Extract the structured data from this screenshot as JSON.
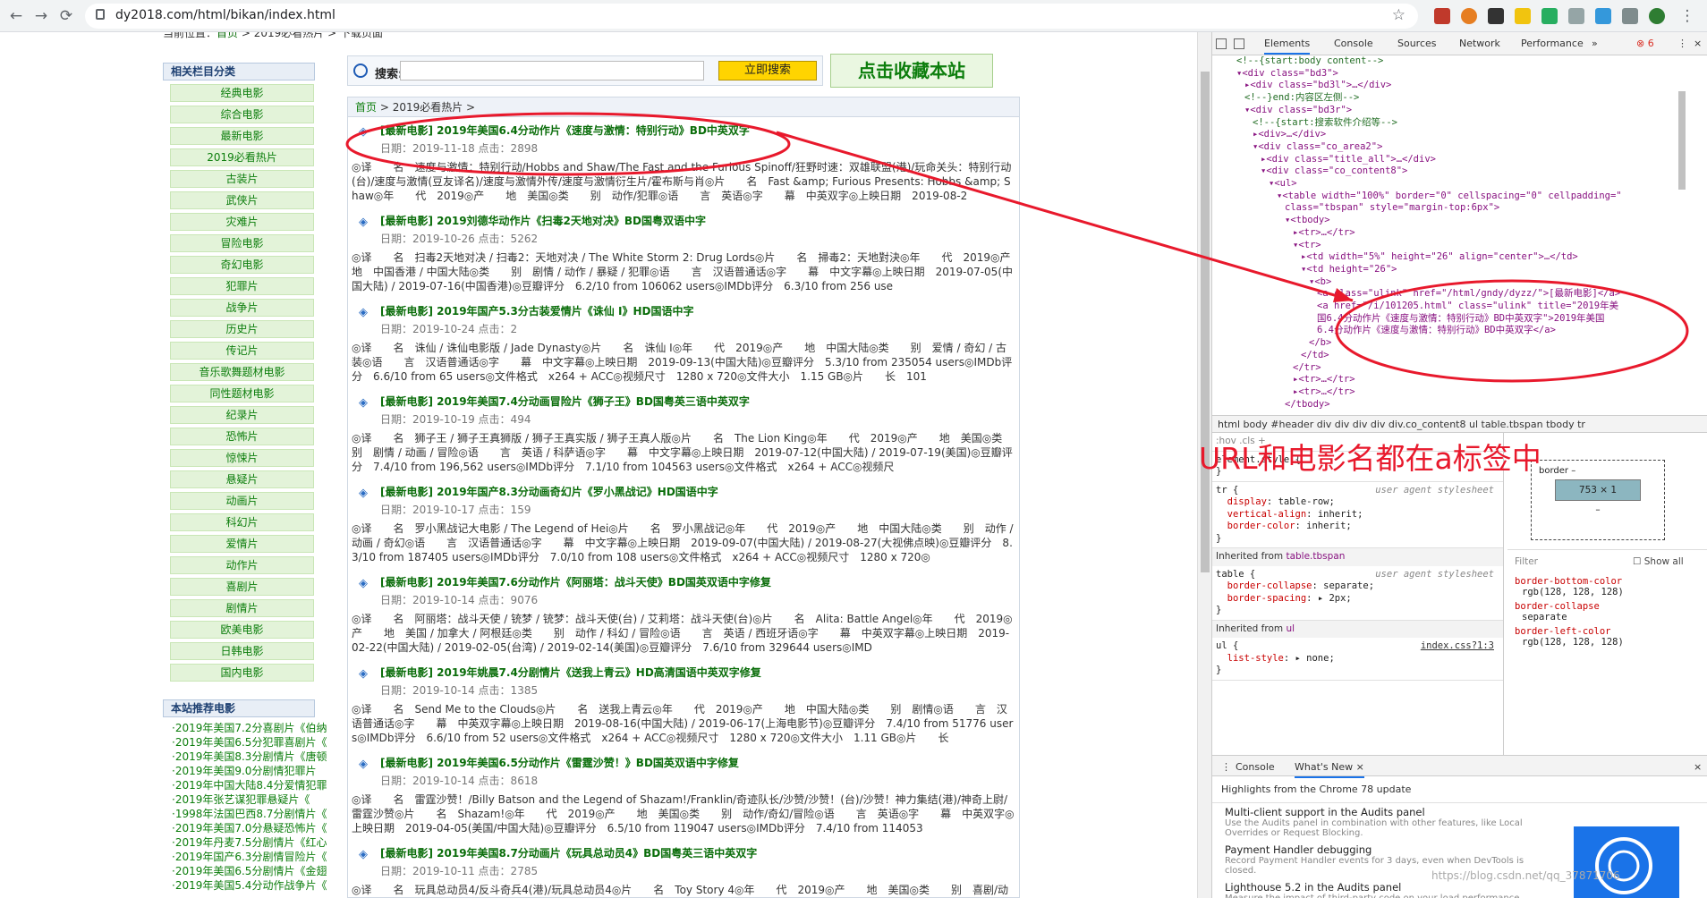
{
  "browser": {
    "url": "dy2018.com/html/bikan/index.html",
    "back": "←",
    "forward": "→",
    "reload": "⟳",
    "star": "☆"
  },
  "page": {
    "crumb_prefix": "当前位置：",
    "crumb_home": "首页",
    "crumb_rest": " > 2019必看热片 > 下载页面",
    "sidebar_heading": "相关栏目分类",
    "categories": [
      "经典电影",
      "综合电影",
      "最新电影",
      "2019必看热片",
      "古装片",
      "武侠片",
      "灾难片",
      "冒险电影",
      "奇幻电影",
      "犯罪片",
      "战争片",
      "历史片",
      "传记片",
      "音乐歌舞题材电影",
      "同性题材电影",
      "纪录片",
      "恐怖片",
      "惊悚片",
      "悬疑片",
      "动画片",
      "科幻片",
      "爱情片",
      "动作片",
      "喜剧片",
      "剧情片",
      "欧美电影",
      "日韩电影",
      "国内电影"
    ],
    "rec_heading": "本站推荐电影",
    "recommended": [
      "·2019年美国7.2分喜剧片《伯纳",
      "·2019年美国6.5分犯罪喜剧片《",
      "·2019年美国8.3分剧情片《唐顿",
      "·2019年美国9.0分剧情犯罪片",
      "·2019年中国大陆8.4分爱情犯罪",
      "·2019年张艺谋犯罪悬疑片《",
      "·1998年法国巴西8.7分剧情片《",
      "·2019年美国7.0分悬疑恐怖片《",
      "·2019年丹麦7.5分剧情片《红心",
      "·2019年国产6.3分剧情冒险片《",
      "·2019年美国6.5分剧情片《金翅",
      "·2019年美国5.4分动作战争片《"
    ],
    "search_label": "搜索:",
    "search_button": "立即搜索",
    "fav_button": "点击收藏本站",
    "list_crumb_home": "首页",
    "list_crumb_rest": " > 2019必看热片 > ",
    "items": [
      {
        "title": "[最新电影] 2019年美国6.4分动作片《速度与激情：特别行动》BD中英双字",
        "meta": "日期：2019-11-18 点击：2898",
        "desc": "◎译　　名　速度与激情：特别行动/Hobbs and Shaw/The Fast and the Furious Spinoff/狂野时速：双雄联盟(港)/玩命关头：特别行动(台)/速度与激情(豆友译名)/速度与激情外传/速度与激情衍生片/霍布斯与肖◎片　　名　Fast &amp; Furious Presents: Hobbs &amp; Shaw◎年　　代　2019◎产　　地　美国◎类　　别　动作/犯罪◎语　　言　英语◎字　　幕　中英双字◎上映日期　2019-08-2"
      },
      {
        "title": "[最新电影] 2019刘德华动作片《扫毒2天地对决》BD国粤双语中字",
        "meta": "日期：2019-10-26 点击：5262",
        "desc": "◎译　　名　扫毒2天地对决 / 扫毒2：天地对决 / The White Storm 2: Drug Lords◎片　　名　掃毒2：天地對決◎年　　代　2019◎产　　地　中国香港 / 中国大陆◎类　　别　剧情 / 动作 / 暴疑 / 犯罪◎语　　言　汉语普通话◎字　　幕　中文字幕◎上映日期　2019-07-05(中国大陆) / 2019-07-16(中国香港)◎豆瓣评分　6.2/10 from 106062 users◎IMDb评分　6.3/10 from 256 use"
      },
      {
        "title": "[最新电影] 2019年国产5.3分古装爱情片《诛仙 Ⅰ》HD国语中字",
        "meta": "日期：2019-10-24 点击：2",
        "desc": "◎译　　名　诛仙 / 诛仙电影版 / Jade Dynasty◎片　　名　诛仙 Ⅰ◎年　　代　2019◎产　　地　中国大陆◎类　　别　爱情 / 奇幻 / 古装◎语　　言　汉语普通话◎字　　幕　中文字幕◎上映日期　2019-09-13(中国大陆)◎豆瓣评分　5.3/10 from 235054 users◎IMDb评分　6.6/10 from 65 users◎文件格式　x264 + ACC◎视频尺寸　1280 x 720◎文件大小　1.15 GB◎片　　长　101"
      },
      {
        "title": "[最新电影] 2019年美国7.4分动画冒险片《狮子王》BD国粤英三语中英双字",
        "meta": "日期：2019-10-19 点击：494",
        "desc": "◎译　　名　狮子王 / 狮子王真狮版 / 狮子王真实版 / 狮子王真人版◎片　　名　The Lion King◎年　　代　2019◎产　　地　美国◎类　　别　剧情 / 动画 / 冒险◎语　　言　英语 / 科萨语◎字　　幕　中文字幕◎上映日期　2019-07-12(中国大陆) / 2019-07-19(美国)◎豆瓣评分　7.4/10 from 196,562 users◎IMDb评分　7.1/10 from 104563 users◎文件格式　x264 + ACC◎视频尺"
      },
      {
        "title": "[最新电影] 2019年国产8.3分动画奇幻片《罗小黑战记》HD国语中字",
        "meta": "日期：2019-10-17 点击：159",
        "desc": "◎译　　名　罗小黑战记大电影 / The Legend of Hei◎片　　名　罗小黑战记◎年　　代　2019◎产　　地　中国大陆◎类　　别　动作 / 动画 / 奇幻◎语　　言　汉语普通话◎字　　幕　中文字幕◎上映日期　2019-09-07(中国大陆) / 2019-08-27(大视佛点映)◎豆瓣评分　8.3/10 from 187405 users◎IMDb评分　7.0/10 from 108 users◎文件格式　x264 + ACC◎视频尺寸　1280 x 720◎"
      },
      {
        "title": "[最新电影] 2019年美国7.6分动作片《阿丽塔：战斗天使》BD国英双语中字修复",
        "meta": "日期：2019-10-14 点击：9076",
        "desc": "◎译　　名　阿丽塔：战斗天使 / 铳梦 / 铳梦：战斗天使(台) / 艾莉塔：战斗天使(台)◎片　　名　Alita: Battle Angel◎年　　代　2019◎产　　地　美国 / 加拿大 / 阿根廷◎类　　别　动作 / 科幻 / 冒险◎语　　言　英语 / 西班牙语◎字　　幕　中英双字幕◎上映日期　2019-02-22(中国大陆) / 2019-02-05(台湾) / 2019-02-14(美国)◎豆瓣评分　7.6/10 from 329644 users◎IMD"
      },
      {
        "title": "[最新电影] 2019年姚晨7.4分剧情片《送我上青云》HD高清国语中英双字修复",
        "meta": "日期：2019-10-14 点击：1385",
        "desc": "◎译　　名　Send Me to the Clouds◎片　　名　送我上青云◎年　　代　2019◎产　　地　中国大陆◎类　　别　剧情◎语　　言　汉语普通话◎字　　幕　中英双字幕◎上映日期　2019-08-16(中国大陆) / 2019-06-17(上海电影节)◎豆瓣评分　7.4/10 from 51776 users◎IMDb评分　6.6/10 from 52 users◎文件格式　x264 + ACC◎视频尺寸　1280 x 720◎文件大小　1.11 GB◎片　　长"
      },
      {
        "title": "[最新电影] 2019年美国6.5分动作片《雷霆沙赞！》BD国英双语中字修复",
        "meta": "日期：2019-10-14 点击：8618",
        "desc": "◎译　　名　雷霆沙赞！/Billy Batson and the Legend of Shazam!/Franklin/奇迹队长/沙赞/沙赞！(台)/沙赞！神力集结(港)/神奇上尉/雷霆沙赞◎片　　名　Shazam!◎年　　代　2019◎产　　地　美国◎类　　别　动作/奇幻/冒险◎语　　言　英语◎字　　幕　中英双字◎上映日期　2019-04-05(美国/中国大陆)◎豆瓣评分　6.5/10 from 119047 users◎IMDb评分　7.4/10 from 114053"
      },
      {
        "title": "[最新电影] 2019年美国8.7分动画片《玩具总动员4》BD国粤英三语中英双字",
        "meta": "日期：2019-10-11 点击：2785",
        "desc": "◎译　　名　玩具总动员4/反斗奇兵4(港)/玩具总动员4◎片　　名　Toy Story 4◎年　　代　2019◎产　　地　美国◎类　　别　喜剧/动画/奇幻/冒险"
      }
    ]
  },
  "devtools": {
    "tabs": [
      "Elements",
      "Console",
      "Sources",
      "Network",
      "Performance",
      "»"
    ],
    "errors": "⊗ 6",
    "dom_lines": [
      {
        "ind": 3,
        "kind": "comment",
        "text": "<!--{start:body content-->"
      },
      {
        "ind": 3,
        "kind": "tag",
        "text": "▾<div class=\"bd3\">"
      },
      {
        "ind": 4,
        "kind": "tag",
        "text": "▸<div class=\"bd3l\">…</div>"
      },
      {
        "ind": 4,
        "kind": "comment",
        "text": "<!--}end:内容区左侧-->"
      },
      {
        "ind": 4,
        "kind": "tag",
        "text": "▾<div class=\"bd3r\">"
      },
      {
        "ind": 5,
        "kind": "comment",
        "text": "<!--{start:搜索软件介绍等-->"
      },
      {
        "ind": 5,
        "kind": "tag",
        "text": "▸<div>…</div>"
      },
      {
        "ind": 5,
        "kind": "tag",
        "text": "▾<div class=\"co_area2\">"
      },
      {
        "ind": 6,
        "kind": "tag",
        "text": "▸<div class=\"title_all\">…</div>"
      },
      {
        "ind": 6,
        "kind": "tag",
        "text": "▾<div class=\"co_content8\">"
      },
      {
        "ind": 7,
        "kind": "tag",
        "text": "▾<ul>"
      },
      {
        "ind": 8,
        "kind": "tag",
        "text": "▾<table width=\"100%\" border=\"0\" cellspacing=\"0\" cellpadding=\""
      },
      {
        "ind": 9,
        "kind": "tag",
        "text": "class=\"tbspan\" style=\"margin-top:6px\">"
      },
      {
        "ind": 9,
        "kind": "tag",
        "text": "▾<tbody>"
      },
      {
        "ind": 10,
        "kind": "tag",
        "text": "▸<tr>…</tr>"
      },
      {
        "ind": 10,
        "kind": "tag",
        "text": "▾<tr>"
      },
      {
        "ind": 11,
        "kind": "tag",
        "text": "▸<td width=\"5%\" height=\"26\" align=\"center\">…</td>"
      },
      {
        "ind": 11,
        "kind": "tag",
        "text": "▾<td height=\"26\">"
      },
      {
        "ind": 12,
        "kind": "tag",
        "text": "▾<b>"
      },
      {
        "ind": 13,
        "kind": "tag",
        "text": "<a class=\"ulink\" href=\"/html/gndy/dyzz/\">[最新电影]</a>"
      },
      {
        "ind": 13,
        "kind": "tag",
        "text": "<a href=\"/i/101205.html\" class=\"ulink\" title=\"2019年美"
      },
      {
        "ind": 13,
        "kind": "tag",
        "text": "国6.4分动作片《速度与激情：特别行动》BD中英双字\">2019年美国"
      },
      {
        "ind": 13,
        "kind": "tag",
        "text": "6.4分动作片《速度与激情：特别行动》BD中英双字</a>"
      },
      {
        "ind": 12,
        "kind": "tag",
        "text": "</b>"
      },
      {
        "ind": 11,
        "kind": "tag",
        "text": "</td>"
      },
      {
        "ind": 10,
        "kind": "tag",
        "text": "</tr>"
      },
      {
        "ind": 10,
        "kind": "tag",
        "text": "▸<tr>…</tr>"
      },
      {
        "ind": 10,
        "kind": "tag",
        "text": "▸<tr>…</tr>"
      },
      {
        "ind": 9,
        "kind": "tag",
        "text": "</tbody>"
      }
    ],
    "breadcrumbs": "html  body  #header  div  div  div  div  div.co_content8  ul  table.tbspan  tbody  tr",
    "styles_filter": ":hov .cls +",
    "element_style": "element.style {",
    "ua_label": "user agent stylesheet",
    "inherited_table": "Inherited from ",
    "inherited_table_sel": "table.tbspan",
    "inherited_ul": "Inherited from ",
    "inherited_ul_sel": "ul",
    "index_css": "index.css?1:3",
    "box_label": "border –",
    "box_size": "753 × 1",
    "filter_label": "Filter",
    "show_all": "Show all",
    "computed": [
      {
        "p": "border-bottom-color",
        "v": "rgb(128, 128, 128)"
      },
      {
        "p": "border-collapse",
        "v": "separate"
      },
      {
        "p": "border-left-color",
        "v": "rgb(128, 128, 128)"
      }
    ],
    "drawer_tabs": [
      "Console",
      "What's New ×"
    ],
    "whats_new_head": "Highlights from the Chrome 78 update",
    "whats_new": [
      {
        "t": "Multi-client support in the Audits panel",
        "d": "Use the Audits panel in combination with other features, like Local Overrides or Request Blocking."
      },
      {
        "t": "Payment Handler debugging",
        "d": "Record Payment Handler events for 3 days, even when DevTools is closed."
      },
      {
        "t": "Lighthouse 5.2 in the Audits panel",
        "d": "Measure the impact of third-party code on your load performance"
      }
    ]
  },
  "annotation": "URL和电影名都在a标签中",
  "watermark": "https://blog.csdn.net/qq_37871706",
  "colors": {
    "annotation_red": "#e8192c",
    "link_green": "#0a6d0a"
  }
}
